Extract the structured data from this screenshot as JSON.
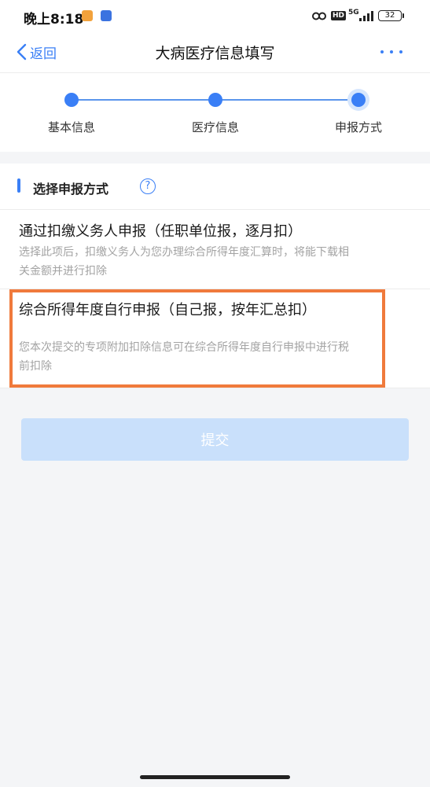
{
  "status_bar": {
    "time": "晚上8:18",
    "network": "5G",
    "hd": "HD",
    "battery": "32"
  },
  "nav": {
    "back_label": "返回",
    "title": "大病医疗信息填写"
  },
  "steps": [
    {
      "label": "基本信息",
      "state": "done"
    },
    {
      "label": "医疗信息",
      "state": "done"
    },
    {
      "label": "申报方式",
      "state": "current"
    }
  ],
  "section": {
    "title": "选择申报方式",
    "help_icon": "?"
  },
  "options": [
    {
      "title": "通过扣缴义务人申报（任职单位报，逐月扣）",
      "description": "选择此项后，扣缴义务人为您办理综合所得年度汇算时，将能下载相关金额并进行扣除"
    },
    {
      "title": "综合所得年度自行申报（自己报，按年汇总扣）",
      "description": "您本次提交的专项附加扣除信息可在综合所得年度自行申报中进行税前扣除",
      "highlighted": true
    }
  ],
  "submit": {
    "label": "提交",
    "enabled": false
  },
  "colors": {
    "accent": "#3a7ff6",
    "highlight_border": "#f07a3c",
    "submit_disabled_bg": "#c9e0fb"
  }
}
